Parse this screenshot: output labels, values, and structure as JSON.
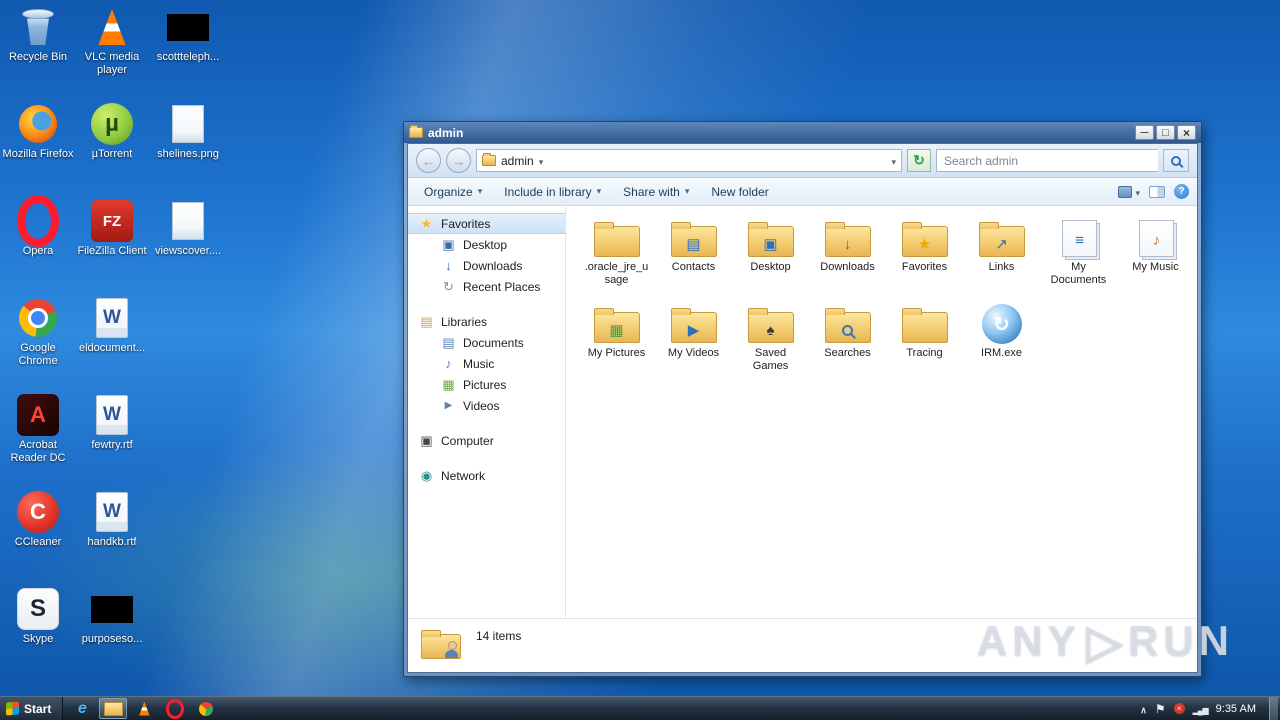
{
  "colors": {
    "accent": "#2f6fb4",
    "folder": "#f0c05a",
    "selection": "#cde2f6",
    "taskbar": "#243444"
  },
  "desktop": {
    "col1": [
      {
        "label": "Recycle Bin",
        "icon": "recycle-bin-icon"
      },
      {
        "label": "Mozilla Firefox",
        "icon": "firefox-icon"
      },
      {
        "label": "Opera",
        "icon": "opera-icon"
      },
      {
        "label": "Google Chrome",
        "icon": "chrome-icon"
      },
      {
        "label": "Acrobat Reader DC",
        "icon": "acrobat-icon"
      },
      {
        "label": "CCleaner",
        "icon": "ccleaner-icon"
      },
      {
        "label": "Skype",
        "icon": "skype-icon"
      }
    ],
    "col2": [
      {
        "label": "VLC media player",
        "icon": "vlc-icon"
      },
      {
        "label": "µTorrent",
        "icon": "utorrent-icon"
      },
      {
        "label": "FileZilla Client",
        "icon": "filezilla-icon"
      },
      {
        "label": "eldocument...",
        "icon": "word-doc-icon"
      },
      {
        "label": "fewtry.rtf",
        "icon": "word-doc-icon"
      },
      {
        "label": "handkb.rtf",
        "icon": "word-doc-icon"
      },
      {
        "label": "purposeso...",
        "icon": "black-file-icon"
      }
    ],
    "col3": [
      {
        "label": "scottteleph...",
        "icon": "black-file-icon"
      },
      {
        "label": "shelines.png",
        "icon": "image-file-icon"
      },
      {
        "label": "viewscover....",
        "icon": "image-file-icon"
      }
    ]
  },
  "window": {
    "title": "admin",
    "nav": {
      "address": "admin",
      "search_placeholder": "Search admin"
    },
    "toolbar": {
      "left": [
        {
          "label": "Organize",
          "cls": "drop"
        },
        {
          "label": "Include in library",
          "cls": "drop"
        },
        {
          "label": "Share with",
          "cls": "drop"
        },
        {
          "label": "New folder",
          "cls": ""
        }
      ]
    },
    "sidebar": {
      "items": [
        {
          "label": "Favorites",
          "type": "root selected",
          "icon": "favorites-star-icon"
        },
        {
          "label": "Desktop",
          "type": "child",
          "icon": "desktop-icon"
        },
        {
          "label": "Downloads",
          "type": "child",
          "icon": "downloads-icon"
        },
        {
          "label": "Recent Places",
          "type": "child",
          "icon": "recent-places-icon"
        },
        {
          "label": "Libraries",
          "type": "root gap",
          "icon": "libraries-icon"
        },
        {
          "label": "Documents",
          "type": "child",
          "icon": "documents-icon"
        },
        {
          "label": "Music",
          "type": "child",
          "icon": "music-icon"
        },
        {
          "label": "Pictures",
          "type": "child",
          "icon": "pictures-icon"
        },
        {
          "label": "Videos",
          "type": "child",
          "icon": "videos-icon"
        },
        {
          "label": "Computer",
          "type": "root gap",
          "icon": "computer-icon"
        },
        {
          "label": "Network",
          "type": "root gap",
          "icon": "network-icon"
        }
      ]
    },
    "files": [
      {
        "label": ".oracle_jre_usage",
        "icon": "folder-icon",
        "glyph": "",
        "glyph_class": ""
      },
      {
        "label": "Contacts",
        "icon": "folder-icon",
        "glyph": "▤",
        "glyph_class": "blue"
      },
      {
        "label": "Desktop",
        "icon": "folder-icon",
        "glyph": "▣",
        "glyph_class": "blue"
      },
      {
        "label": "Downloads",
        "icon": "folder-icon",
        "glyph": "↓",
        "glyph_class": "blue"
      },
      {
        "label": "Favorites",
        "icon": "folder-icon",
        "glyph": "★",
        "glyph_class": "gold"
      },
      {
        "label": "Links",
        "icon": "folder-icon",
        "glyph": "↗",
        "glyph_class": "blue"
      },
      {
        "label": "My Documents",
        "icon": "stack-icon",
        "glyph": "≡",
        "glyph_class": "blue"
      },
      {
        "label": "My Music",
        "icon": "stack-icon",
        "glyph": "♪",
        "glyph_class": "orange"
      },
      {
        "label": "My Pictures",
        "icon": "folder-icon",
        "glyph": "▦",
        "glyph_class": "green"
      },
      {
        "label": "My Videos",
        "icon": "folder-icon",
        "glyph": "▶",
        "glyph_class": "blue"
      },
      {
        "label": "Saved Games",
        "icon": "folder-icon",
        "glyph": "♠",
        "glyph_class": "dark"
      },
      {
        "label": "Searches",
        "icon": "folder-icon",
        "glyph": "",
        "glyph_class": "magnifier"
      },
      {
        "label": "Tracing",
        "icon": "folder-icon",
        "glyph": "",
        "glyph_class": ""
      },
      {
        "label": "IRM.exe",
        "icon": "exe-icon",
        "glyph": "↻",
        "glyph_class": "white"
      }
    ],
    "status": {
      "items_count": "14 items"
    }
  },
  "taskbar": {
    "start_label": "Start",
    "apps": [
      {
        "icon": "ie-icon",
        "cls": ""
      },
      {
        "icon": "explorer-icon",
        "cls": "active"
      },
      {
        "icon": "vlc-icon-sm",
        "cls": ""
      },
      {
        "icon": "opera-icon-sm",
        "cls": ""
      },
      {
        "icon": "chrome-icon-sm",
        "cls": ""
      }
    ],
    "tray": {
      "clock": "9:35 AM"
    }
  },
  "watermark": {
    "left": "ANY",
    "right": "RUN"
  }
}
